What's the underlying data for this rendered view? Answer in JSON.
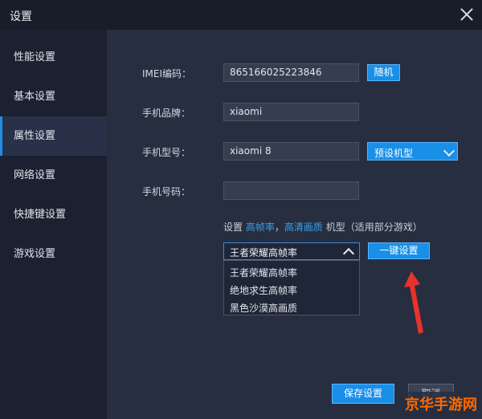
{
  "window": {
    "title": "设置"
  },
  "sidebar": {
    "items": [
      {
        "label": "性能设置"
      },
      {
        "label": "基本设置"
      },
      {
        "label": "属性设置"
      },
      {
        "label": "网络设置"
      },
      {
        "label": "快捷键设置"
      },
      {
        "label": "游戏设置"
      }
    ],
    "active_index": 2
  },
  "form": {
    "imei_label": "IMEI编码：",
    "imei_value": "865166025223846",
    "random_button": "随机",
    "brand_label": "手机品牌：",
    "brand_value": "xiaomi",
    "model_label": "手机型号：",
    "model_value": "xiaomi 8",
    "preset_model_button": "预设机型",
    "phone_label": "手机号码：",
    "phone_value": ""
  },
  "hint": {
    "prefix": "设置 ",
    "link1": "高帧率",
    "sep": "，",
    "link2": "高清画质",
    "suffix": " 机型（适用部分游戏）"
  },
  "game_select": {
    "selected": "王者荣耀高帧率",
    "options": [
      "王者荣耀高帧率",
      "绝地求生高帧率",
      "黑色沙漠高画质"
    ]
  },
  "one_key_button": "一键设置",
  "footer": {
    "save_button": "保存设置",
    "cancel_button": "取消"
  },
  "watermark": "京华手游网",
  "colors": {
    "accent": "#1a8fe8",
    "link": "#3aa0f0",
    "arrow": "#e8322c",
    "watermark": "#ff6a00"
  }
}
